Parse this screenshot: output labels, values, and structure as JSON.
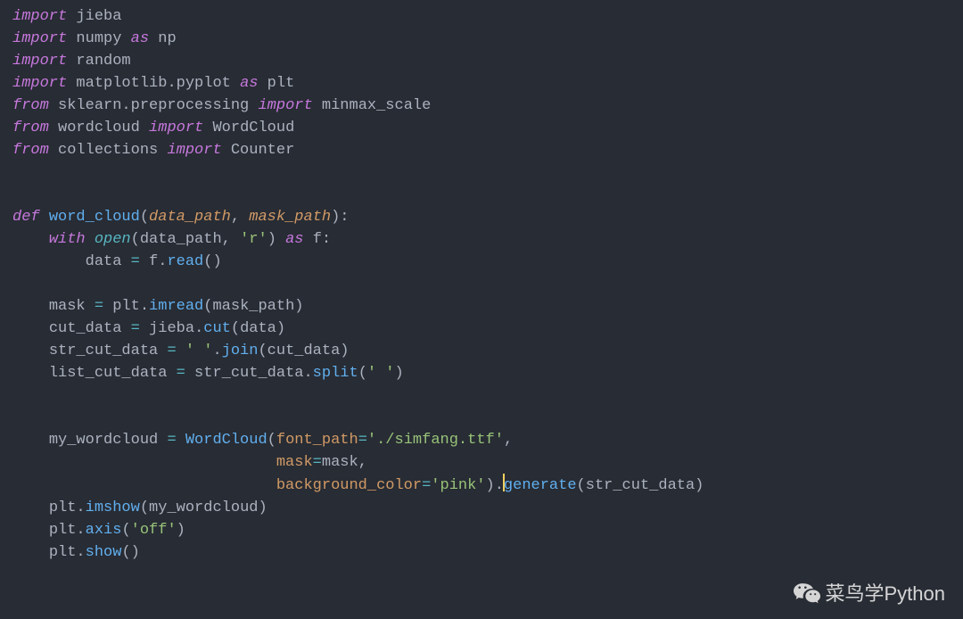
{
  "code": {
    "l1": {
      "kw1": "import",
      "mod": "jieba"
    },
    "l2": {
      "kw1": "import",
      "mod": "numpy",
      "kw2": "as",
      "alias": "np"
    },
    "l3": {
      "kw1": "import",
      "mod": "random"
    },
    "l4": {
      "kw1": "import",
      "mod": "matplotlib.pyplot",
      "kw2": "as",
      "alias": "plt"
    },
    "l5": {
      "kw1": "from",
      "mod": "sklearn.preprocessing",
      "kw2": "import",
      "name": "minmax_scale"
    },
    "l6": {
      "kw1": "from",
      "mod": "wordcloud",
      "kw2": "import",
      "name": "WordCloud"
    },
    "l7": {
      "kw1": "from",
      "mod": "collections",
      "kw2": "import",
      "name": "Counter"
    },
    "l10": {
      "kw": "def",
      "fn": "word_cloud",
      "p1": "data_path",
      "p2": "mask_path"
    },
    "l11": {
      "kw1": "with",
      "fn": "open",
      "arg1": "data_path",
      "str": "'r'",
      "kw2": "as",
      "var": "f"
    },
    "l12": {
      "lhs": "data",
      "obj": "f",
      "m": "read"
    },
    "l14": {
      "lhs": "mask",
      "obj": "plt",
      "m": "imread",
      "arg": "mask_path"
    },
    "l15": {
      "lhs": "cut_data",
      "obj": "jieba",
      "m": "cut",
      "arg": "data"
    },
    "l16": {
      "lhs": "str_cut_data",
      "str": "' '",
      "m": "join",
      "arg": "cut_data"
    },
    "l17": {
      "lhs": "list_cut_data",
      "obj": "str_cut_data",
      "m": "split",
      "str": "' '"
    },
    "l20": {
      "lhs": "my_wordcloud",
      "cls": "WordCloud",
      "kw1": "font_path",
      "s1": "'./simfang.ttf'"
    },
    "l21": {
      "kw": "mask",
      "val": "mask"
    },
    "l22": {
      "kw": "background_color",
      "s": "'pink'",
      "m": "generate",
      "arg": "str_cut_data"
    },
    "l23": {
      "obj": "plt",
      "m": "imshow",
      "arg": "my_wordcloud"
    },
    "l24": {
      "obj": "plt",
      "m": "axis",
      "s": "'off'"
    },
    "l25": {
      "obj": "plt",
      "m": "show"
    }
  },
  "watermark": {
    "text": "菜鸟学Python"
  }
}
